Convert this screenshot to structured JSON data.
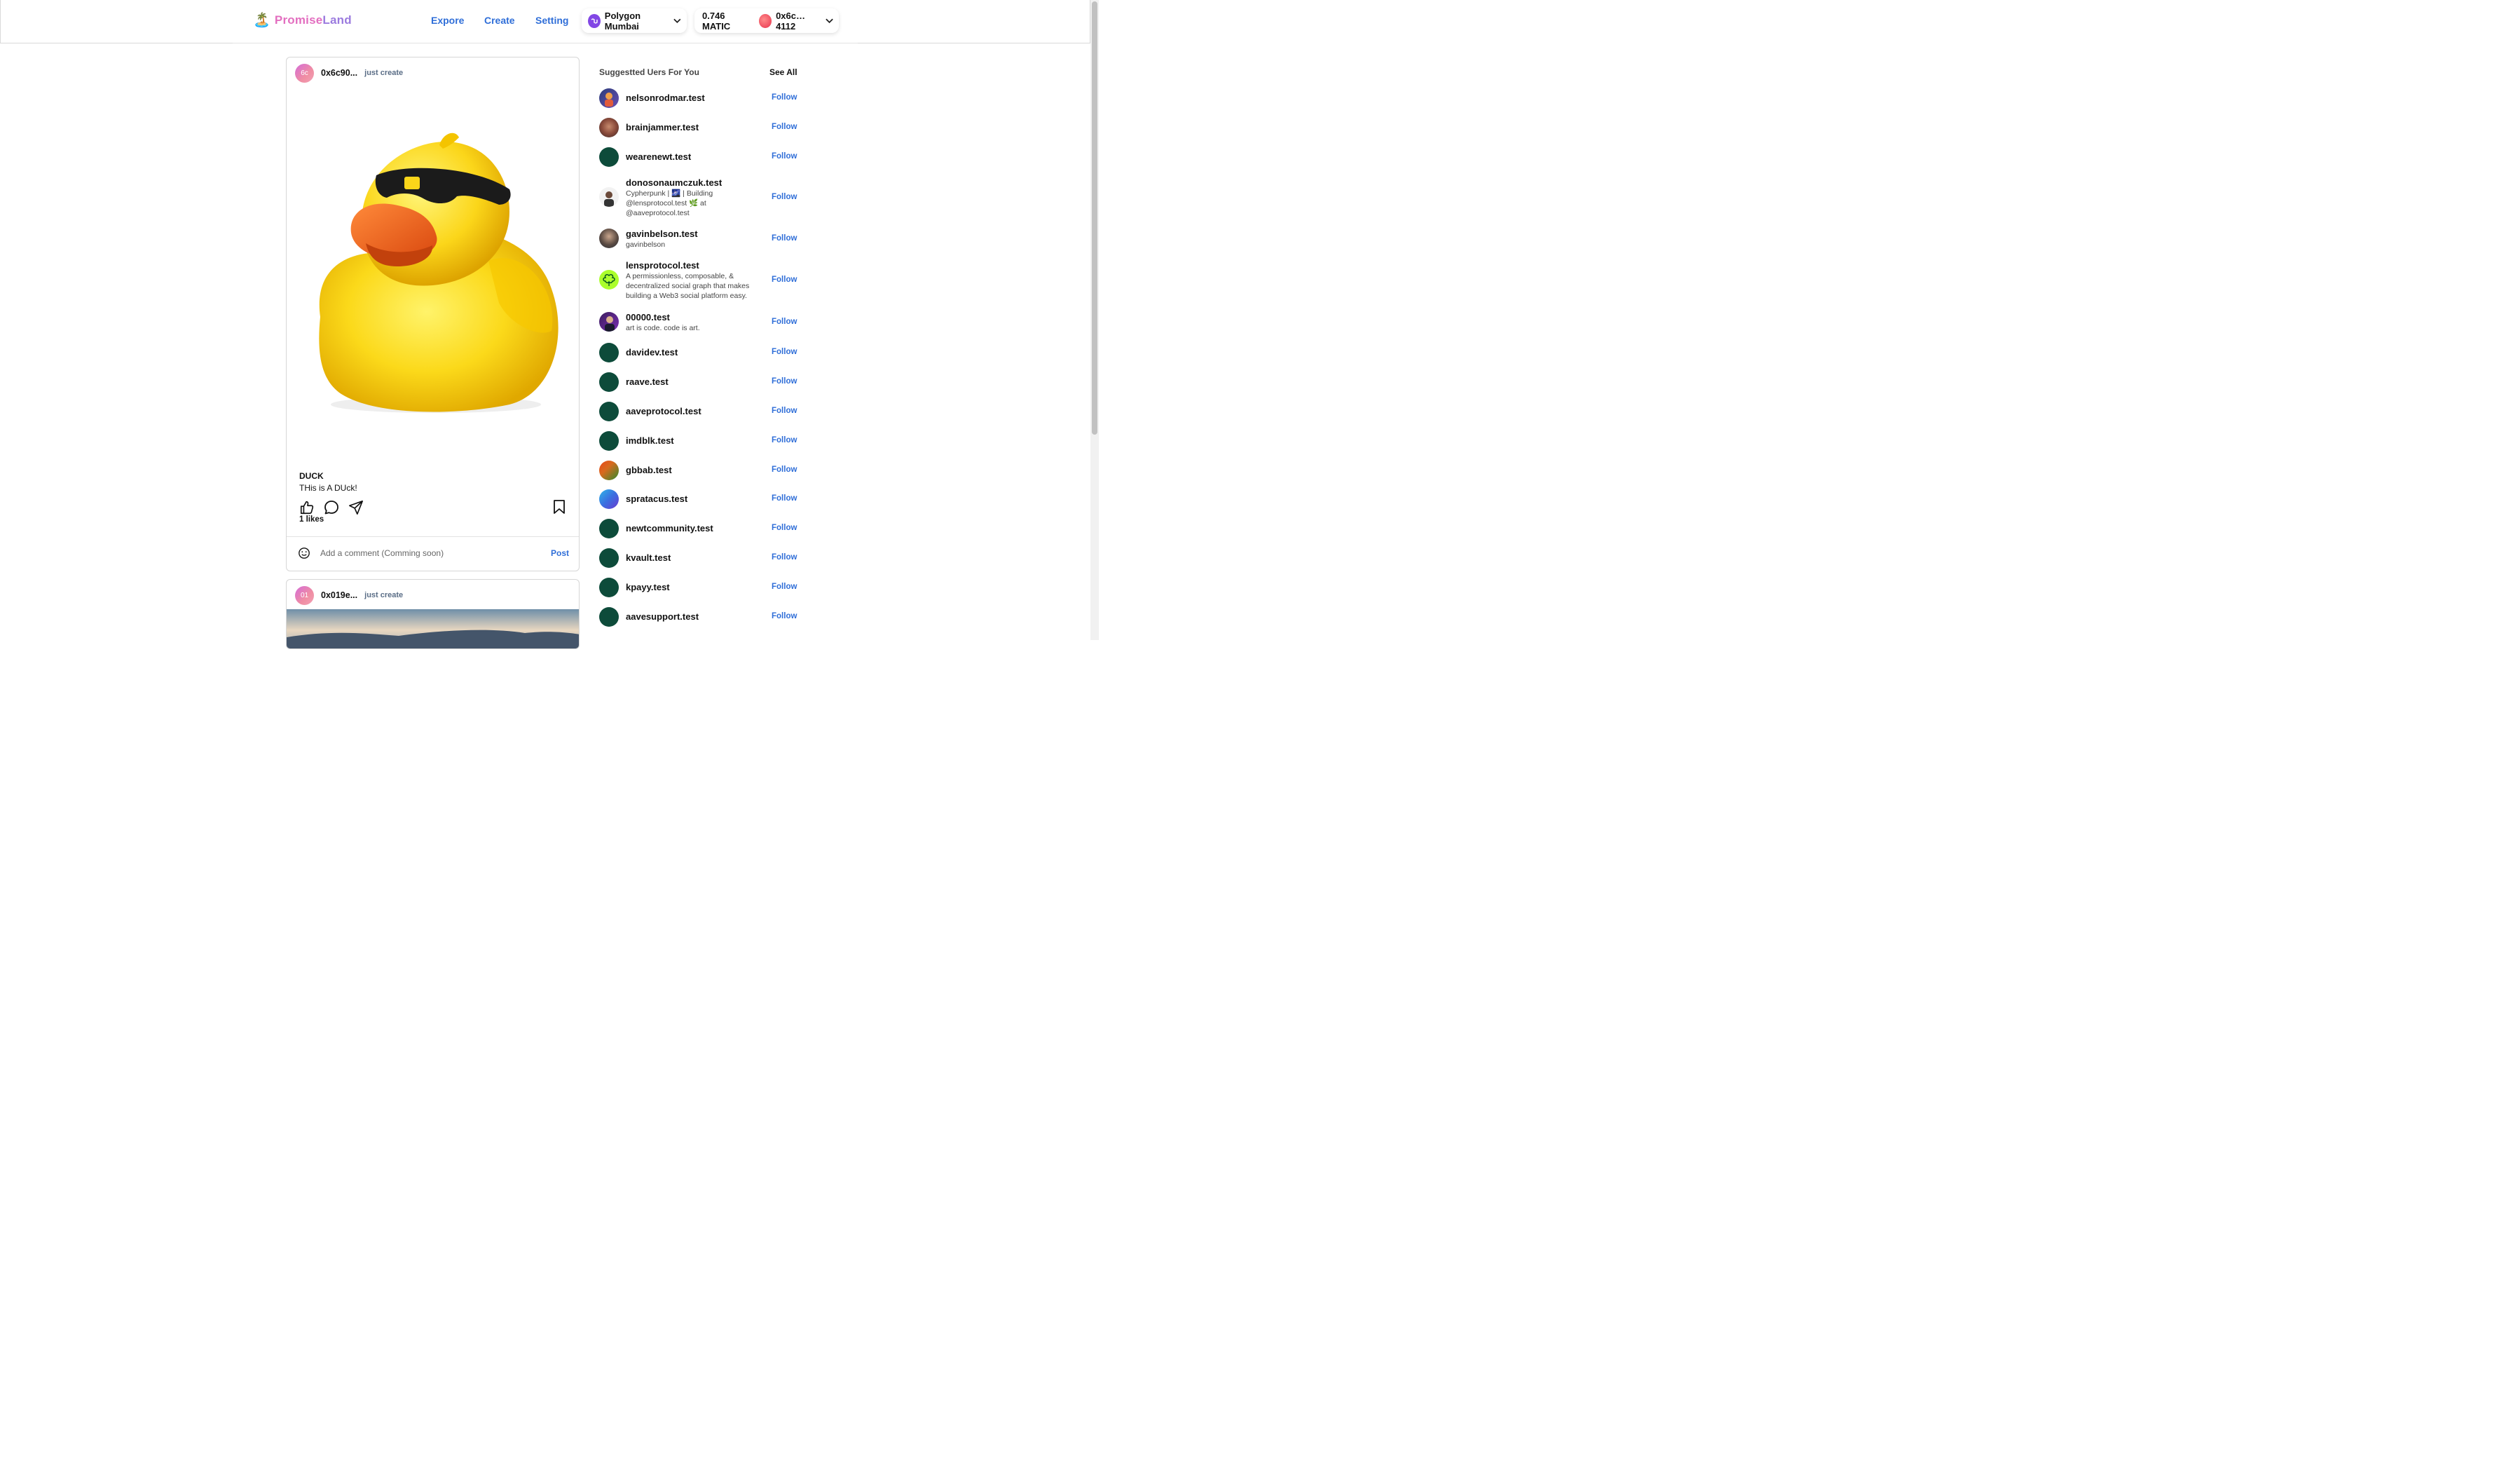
{
  "header": {
    "logo_emoji": "🏝️",
    "brand_left": "Promise",
    "brand_right": "Land",
    "nav": [
      "Expore",
      "Create",
      "Setting"
    ],
    "network": "Polygon Mumbai",
    "balance": "0.746 MATIC",
    "account": "0x6c…4112"
  },
  "posts": [
    {
      "avatar_initials": "6c",
      "user": "0x6c90...",
      "time": "just create",
      "title": "DUCK",
      "description": "THis is A DUck!",
      "likes": "1 likes",
      "comment_placeholder": "Add a comment (Comming soon)",
      "post_label": "Post"
    },
    {
      "avatar_initials": "01",
      "user": "0x019e...",
      "time": "just create"
    }
  ],
  "suggestions": {
    "heading": "Suggestted Uers For You",
    "see_all": "See All",
    "follow_label": "Follow",
    "users": [
      {
        "name": "nelsonrodmar.test",
        "bio": ""
      },
      {
        "name": "brainjammer.test",
        "bio": ""
      },
      {
        "name": "wearenewt.test",
        "bio": ""
      },
      {
        "name": "donosonaumczuk.test",
        "bio": "Cypherpunk | 🌌 | Building @lensprotocol.test 🌿 at @aaveprotocol.test"
      },
      {
        "name": "gavinbelson.test",
        "bio": "gavinbelson"
      },
      {
        "name": "lensprotocol.test",
        "bio": "A permissionless, composable, & decentralized social graph that makes building a Web3 social platform easy."
      },
      {
        "name": "00000.test",
        "bio": "art is code. code is art."
      },
      {
        "name": "davidev.test",
        "bio": ""
      },
      {
        "name": "raave.test",
        "bio": ""
      },
      {
        "name": "aaveprotocol.test",
        "bio": ""
      },
      {
        "name": "imdblk.test",
        "bio": ""
      },
      {
        "name": "gbbab.test",
        "bio": ""
      },
      {
        "name": "spratacus.test",
        "bio": ""
      },
      {
        "name": "newtcommunity.test",
        "bio": ""
      },
      {
        "name": "kvault.test",
        "bio": ""
      },
      {
        "name": "kpayy.test",
        "bio": ""
      },
      {
        "name": "aavesupport.test",
        "bio": ""
      }
    ]
  },
  "colors": {
    "accent": "#2f6ed8",
    "brand_pink": "#e36fc0",
    "default_avatar": "#0d4b3a"
  }
}
